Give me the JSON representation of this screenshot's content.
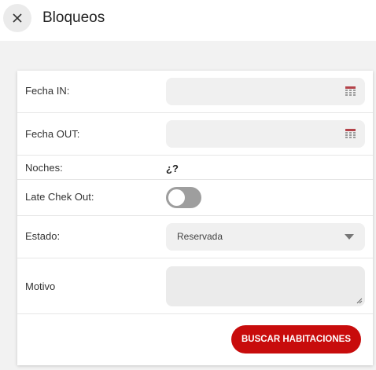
{
  "header": {
    "title": "Bloqueos",
    "close_icon": "close-icon"
  },
  "form": {
    "fecha_in": {
      "label": "Fecha IN:",
      "value": "",
      "icon": "calendar-icon"
    },
    "fecha_out": {
      "label": "Fecha OUT:",
      "value": "",
      "icon": "calendar-icon"
    },
    "noches": {
      "label": "Noches:",
      "value": "¿?"
    },
    "late_check_out": {
      "label": "Late Chek Out:",
      "enabled": false
    },
    "estado": {
      "label": "Estado:",
      "selected": "Reservada"
    },
    "motivo": {
      "label": "Motivo",
      "value": ""
    },
    "search_button_label": "BUSCAR HABITACIONES"
  },
  "colors": {
    "accent": "#c80c0c",
    "field_bg": "#f0f0f0",
    "page_bg": "#f2f2f2",
    "toggle_off": "#9e9e9e",
    "calendar_icon": "#b4434a"
  }
}
